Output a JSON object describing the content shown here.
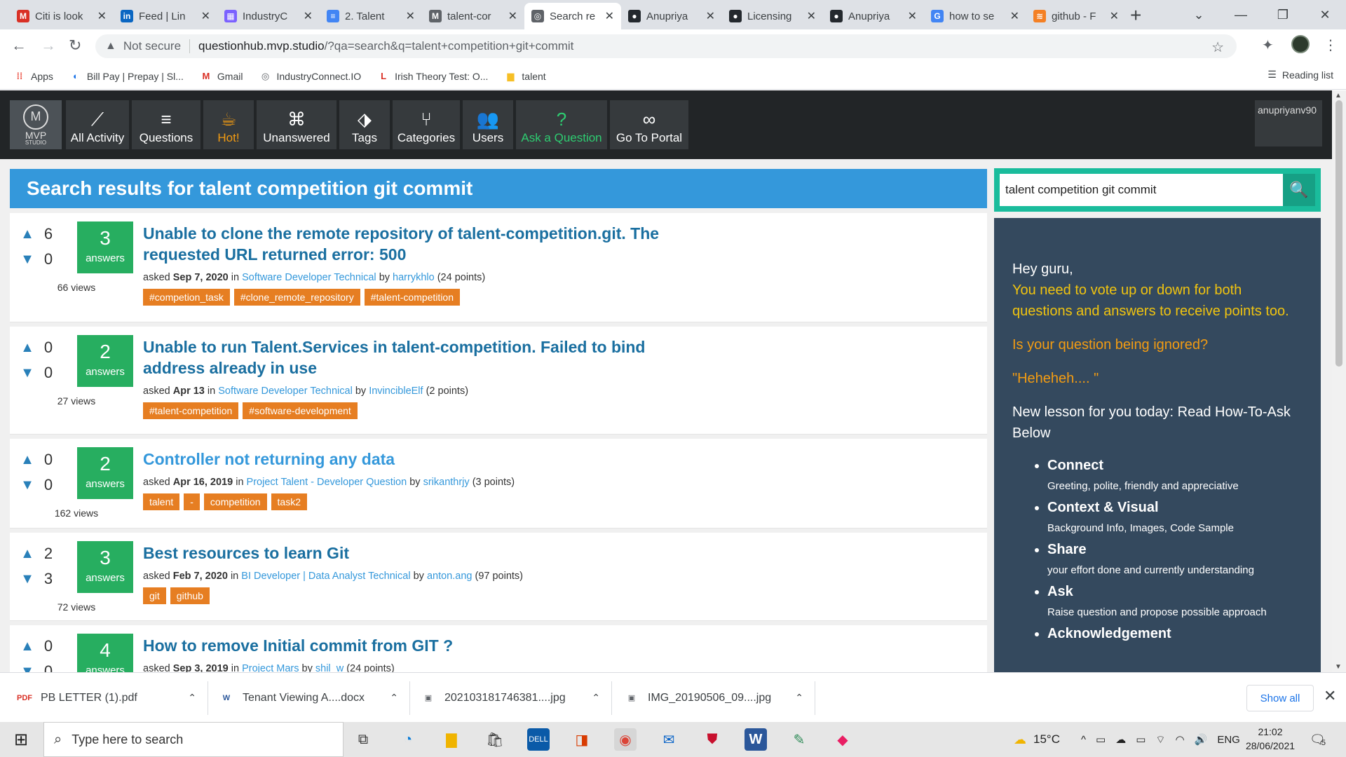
{
  "browser": {
    "tabs": [
      {
        "title": "Citi is look",
        "favicon": "gmail-icon",
        "color": "#d93025",
        "glyph": "M"
      },
      {
        "title": "Feed | Lin",
        "favicon": "linkedin-icon",
        "color": "#0a66c2",
        "glyph": "in"
      },
      {
        "title": "IndustryC",
        "favicon": "grid-icon",
        "color": "#7b61ff",
        "glyph": "▦"
      },
      {
        "title": "2. Talent",
        "favicon": "docs-icon",
        "color": "#4285f4",
        "glyph": "≡"
      },
      {
        "title": "talent-cor",
        "favicon": "mvp-icon",
        "color": "#5f6368",
        "glyph": "M"
      },
      {
        "title": "Search re",
        "favicon": "globe-icon",
        "color": "#5f6368",
        "glyph": "◎"
      },
      {
        "title": "Anupriya",
        "favicon": "github-icon",
        "color": "#24292e",
        "glyph": "●"
      },
      {
        "title": "Licensing",
        "favicon": "github-icon",
        "color": "#24292e",
        "glyph": "●"
      },
      {
        "title": "Anupriya",
        "favicon": "github-icon",
        "color": "#24292e",
        "glyph": "●"
      },
      {
        "title": "how to se",
        "favicon": "google-icon",
        "color": "#4285f4",
        "glyph": "G"
      },
      {
        "title": "github - F",
        "favicon": "stackoverflow-icon",
        "color": "#f48024",
        "glyph": "≋"
      }
    ],
    "active_tab": 5,
    "url": {
      "security": "Not secure",
      "host": "questionhub.mvp.studio",
      "path": "/?qa=search&q=talent+competition+git+commit"
    },
    "bookmarks": [
      {
        "label": "Apps",
        "icon": "apps-icon"
      },
      {
        "label": "Bill Pay | Prepay | Sl...",
        "icon": "billpay-icon"
      },
      {
        "label": "Gmail",
        "icon": "gmail-icon"
      },
      {
        "label": "IndustryConnect.IO",
        "icon": "globe-icon"
      },
      {
        "label": "Irish Theory Test: O...",
        "icon": "irish-icon"
      },
      {
        "label": "talent",
        "icon": "folder-icon"
      }
    ],
    "reading_list": "Reading list"
  },
  "site": {
    "logo_text": "MVP",
    "logo_sub": "STUDIO",
    "nav": [
      {
        "label": "All Activity",
        "icon": "activity-icon",
        "glyph": "⟋"
      },
      {
        "label": "Questions",
        "icon": "questions-icon",
        "glyph": "≡"
      },
      {
        "label": "Hot!",
        "icon": "coffee-icon",
        "glyph": "☕"
      },
      {
        "label": "Unanswered",
        "icon": "unanswered-icon",
        "glyph": "⌘"
      },
      {
        "label": "Tags",
        "icon": "tag-icon",
        "glyph": "⬗"
      },
      {
        "label": "Categories",
        "icon": "categories-icon",
        "glyph": "⑂"
      },
      {
        "label": "Users",
        "icon": "users-icon",
        "glyph": "👥"
      },
      {
        "label": "Ask a Question",
        "icon": "question-icon",
        "glyph": "?"
      },
      {
        "label": "Go To Portal",
        "icon": "infinity-icon",
        "glyph": "∞"
      }
    ],
    "username": "anupriyanv90",
    "results_title": "Search results for talent competition git commit",
    "search_value": "talent competition git commit"
  },
  "questions": [
    {
      "up": "6",
      "down": "0",
      "answers": "3",
      "answers_label": "answers",
      "views": "66 views",
      "title": "Unable to clone the remote repository of talent-competition.git. The requested URL returned error: 500",
      "asked": "asked",
      "date": "Sep 7, 2020",
      "in": "in",
      "category": "Software Developer Technical",
      "by": "by",
      "user": "harrykhlo",
      "points": "(24 points)",
      "tags": [
        "#competion_task",
        "#clone_remote_repository",
        "#talent-competition"
      ]
    },
    {
      "up": "0",
      "down": "0",
      "answers": "2",
      "answers_label": "answers",
      "views": "27 views",
      "title": "Unable to run Talent.Services in talent-competition. Failed to bind address already in use",
      "asked": "asked",
      "date": "Apr 13",
      "in": "in",
      "category": "Software Developer Technical",
      "by": "by",
      "user": "InvincibleElf",
      "points": "(2 points)",
      "tags": [
        "#talent-competition",
        "#software-development"
      ]
    },
    {
      "up": "0",
      "down": "0",
      "answers": "2",
      "answers_label": "answers",
      "views": "162 views",
      "title": "Controller not returning any data",
      "asked": "asked",
      "date": "Apr 16, 2019",
      "in": "in",
      "category": "Project Talent - Developer Question",
      "by": "by",
      "user": "srikanthrjy",
      "points": "(3 points)",
      "tags": [
        "talent",
        "-",
        "competition",
        "task2"
      ]
    },
    {
      "up": "2",
      "down": "3",
      "answers": "3",
      "answers_label": "answers",
      "views": "72 views",
      "title": "Best resources to learn Git",
      "asked": "asked",
      "date": "Feb 7, 2020",
      "in": "in",
      "category": "BI Developer | Data Analyst Technical",
      "by": "by",
      "user": "anton.ang",
      "points": "(97 points)",
      "tags": [
        "git",
        "github"
      ]
    },
    {
      "up": "0",
      "down": "0",
      "answers": "4",
      "answers_label": "answers",
      "views": "",
      "title": "How to remove Initial commit from GIT ?",
      "asked": "asked",
      "date": "Sep 3, 2019",
      "in": "in",
      "category": "Project Mars",
      "by": "by",
      "user": "shil_w",
      "points": "(24 points)",
      "tags": []
    }
  ],
  "sidebar": {
    "greeting": "Hey guru,",
    "vote_msg": "You need to vote up or down for both questions and answers to receive points too.",
    "ignored": "Is your question being ignored?",
    "heheh": "\"Heheheh.... \"",
    "lesson": "New lesson for you today: Read How-To-Ask Below",
    "items": [
      {
        "title": "Connect",
        "desc": "Greeting, polite, friendly and appreciative"
      },
      {
        "title": "Context & Visual",
        "desc": "Background Info, Images, Code Sample"
      },
      {
        "title": "Share",
        "desc": "your effort done and currently understanding"
      },
      {
        "title": "Ask",
        "desc": "Raise question and propose possible approach"
      },
      {
        "title": "Acknowledgement",
        "desc": ""
      }
    ]
  },
  "downloads": {
    "items": [
      {
        "name": "PB LETTER (1).pdf",
        "icon": "pdf-icon"
      },
      {
        "name": "Tenant Viewing A....docx",
        "icon": "word-doc-icon"
      },
      {
        "name": "202103181746381....jpg",
        "icon": "image-file-icon"
      },
      {
        "name": "IMG_20190506_09....jpg",
        "icon": "image-file-icon"
      }
    ],
    "show_all": "Show all"
  },
  "taskbar": {
    "search_placeholder": "Type here to search",
    "weather": "15°C",
    "language": "ENG",
    "time": "21:02",
    "date": "28/06/2021",
    "notifications": "5"
  }
}
